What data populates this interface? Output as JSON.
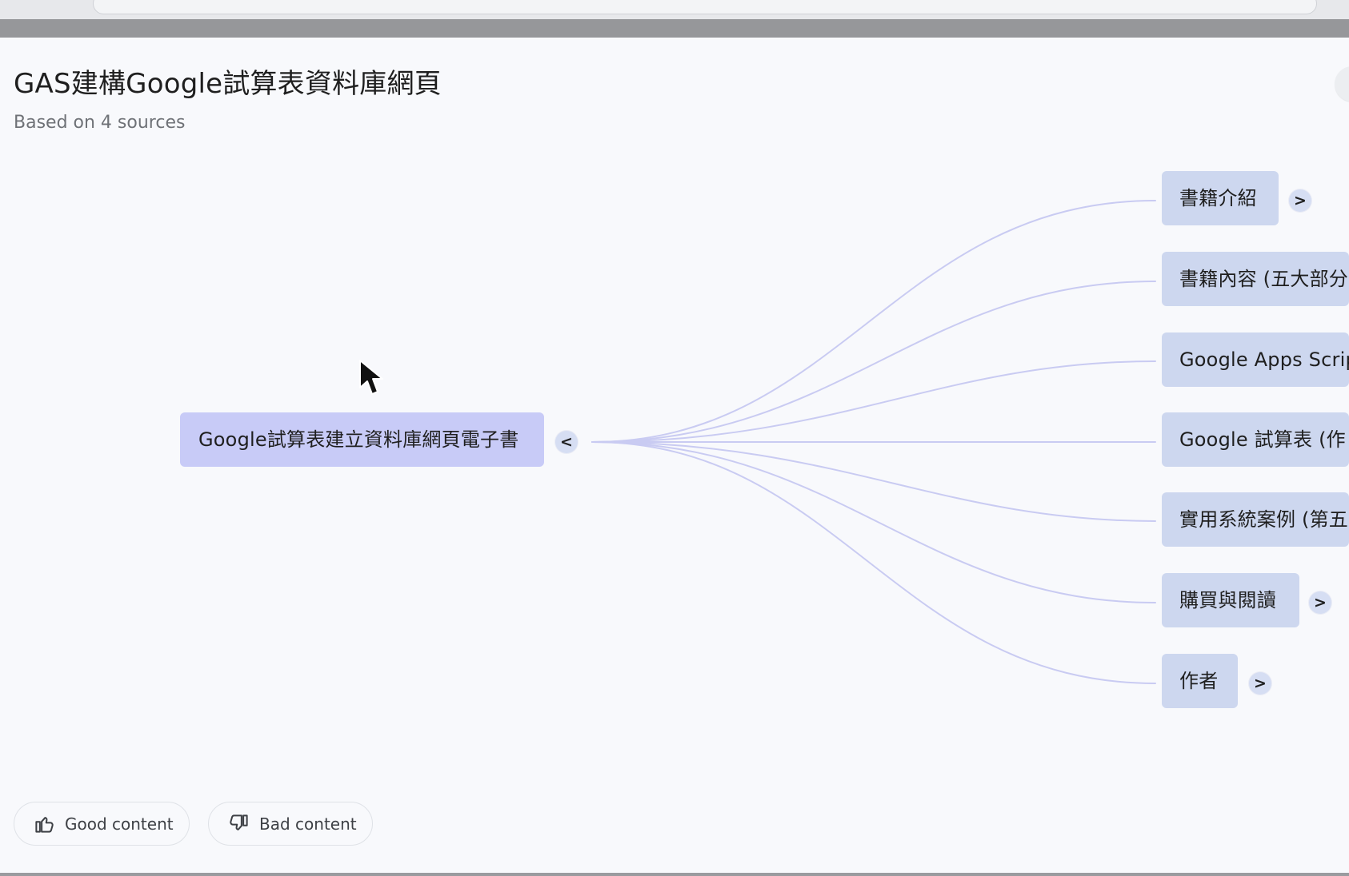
{
  "mindmap": {
    "title": "GAS建構Google試算表資料庫網頁",
    "subtitle": "Based on 4 sources",
    "root": {
      "label": "Google試算表建立資料庫網頁電子書",
      "toggle": "<"
    },
    "children": [
      {
        "label": "書籍介紹",
        "toggle": ">"
      },
      {
        "label": "書籍內容 (五大部分"
      },
      {
        "label": "Google Apps Scrip"
      },
      {
        "label": "Google 試算表 (作"
      },
      {
        "label": "實用系統案例 (第五"
      },
      {
        "label": "購買與閱讀",
        "toggle": ">"
      },
      {
        "label": "作者",
        "toggle": ">"
      }
    ]
  },
  "feedback": {
    "good_label": "Good content",
    "bad_label": "Bad content"
  },
  "colors": {
    "root_node": "#c8cbf7",
    "child_node": "#cdd7ef",
    "connector": "#c9cbf2",
    "toggle": "#d6def3",
    "background": "#f8f9fc"
  }
}
